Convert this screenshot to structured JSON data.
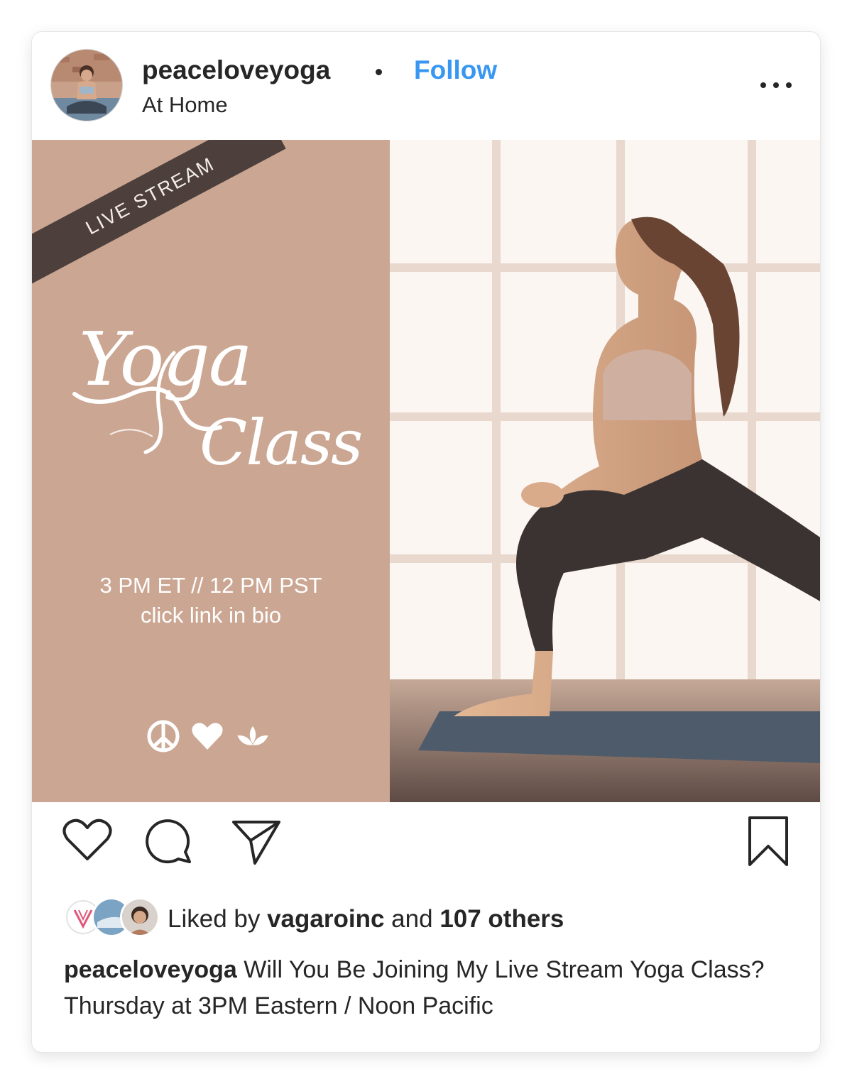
{
  "post_header": {
    "username": "peaceloveyoga",
    "separator": "•",
    "follow_label": "Follow",
    "location": "At Home",
    "more_icon": "more-horizontal-icon"
  },
  "post_image": {
    "ribbon_text": "LIVE STREAM",
    "title_line1": "Yoga",
    "title_line2": "Class",
    "schedule": "3 PM ET // 12 PM PST",
    "cta": "click link in bio",
    "symbols": [
      "peace-icon",
      "heart-icon",
      "lotus-icon"
    ],
    "panel_color": "#cba793"
  },
  "actions": {
    "like_icon": "heart-outline-icon",
    "comment_icon": "comment-icon",
    "share_icon": "paper-plane-icon",
    "save_icon": "bookmark-icon"
  },
  "likes": {
    "prefix": "Liked by ",
    "user": "vagaroinc",
    "middle": " and ",
    "others": "107 others"
  },
  "caption": {
    "username": "peaceloveyoga",
    "text": " Will You Be Joining My Live Stream Yoga Class? Thursday at 3PM Eastern / Noon Pacific"
  },
  "colors": {
    "follow": "#3897f0",
    "text": "#262626",
    "ribbon": "#4d403c"
  }
}
